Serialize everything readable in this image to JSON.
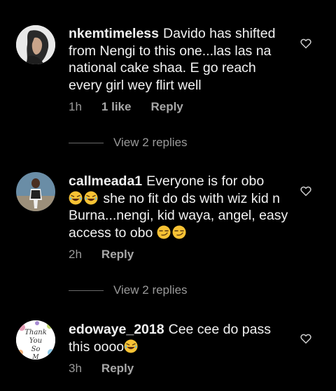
{
  "comments": [
    {
      "username": "nkemtimeless",
      "text": "Davido has shifted from Nengi to this one...las las na national cake shaa. E go reach every girl wey flirt well",
      "time": "1h",
      "likes": "1 like",
      "reply": "Reply",
      "view_replies": "View 2 replies"
    },
    {
      "username": "callmeada1",
      "text_a": "Everyone is for obo",
      "text_b": "she no fit do ds with wiz kid n Burna...nengi, kid waya, angel, easy access to obo",
      "time": "2h",
      "reply": "Reply",
      "view_replies": "View 2 replies"
    },
    {
      "username": "edowaye_2018",
      "text": "Cee cee do pass this oooo",
      "time": "3h",
      "reply": "Reply",
      "avatar_text": [
        "Thank",
        "You",
        "So",
        "M"
      ]
    }
  ],
  "colors": {
    "background": "#000000",
    "text": "#f2f2f2",
    "meta": "#9a9a9a"
  },
  "icons": [
    "heart-icon",
    "laughing-emoji",
    "smirk-emoji"
  ]
}
